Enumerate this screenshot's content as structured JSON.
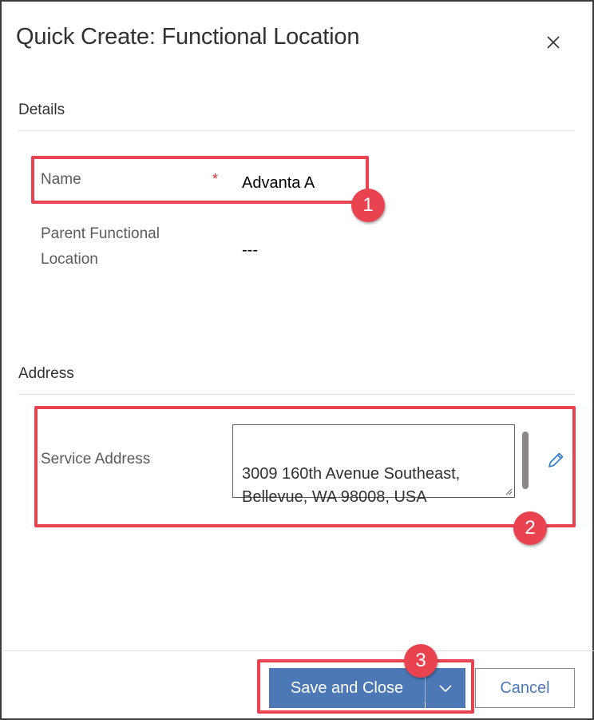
{
  "dialog": {
    "title": "Quick Create: Functional Location",
    "close_icon": "close-icon"
  },
  "details": {
    "section_title": "Details",
    "name_label": "Name",
    "required_marker": "*",
    "name_value": "Advanta A",
    "parent_label_line1": "Parent Functional",
    "parent_label_line2": "Location",
    "parent_value": "---"
  },
  "address": {
    "section_title": "Address",
    "service_label": "Service Address",
    "service_value": "3009 160th Avenue Southeast,\nBellevue, WA 98008, USA",
    "edit_icon": "pencil-icon"
  },
  "footer": {
    "save_label": "Save and Close",
    "dropdown_icon": "chevron-down-icon",
    "cancel_label": "Cancel"
  },
  "annotations": {
    "step1": "1",
    "step2": "2",
    "step3": "3",
    "highlight_color": "#e8434f"
  },
  "colors": {
    "primary_button": "#4c79b6",
    "required": "#d13438"
  }
}
